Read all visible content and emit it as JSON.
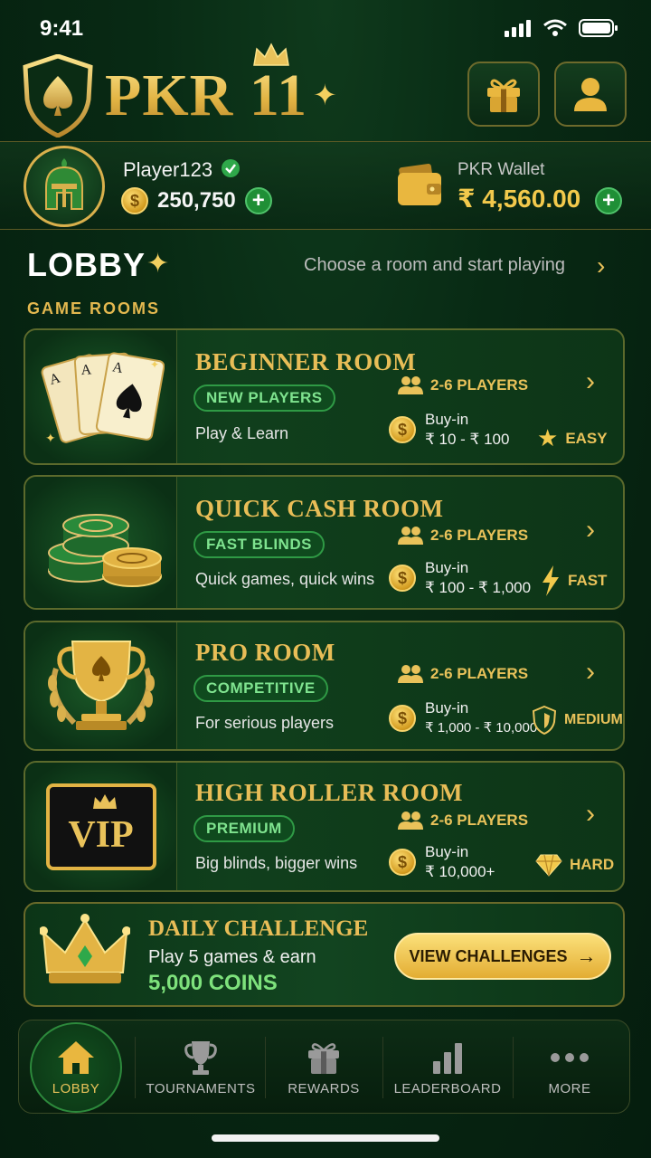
{
  "status": {
    "time": "9:41"
  },
  "header": {
    "brand": "PKR 11",
    "gift_icon": "gift-icon",
    "profile_icon": "user-icon"
  },
  "profile": {
    "username": "Player123",
    "coins": "250,750",
    "wallet_label": "PKR Wallet",
    "wallet_amount": "₹ 4,560.00"
  },
  "lobby": {
    "title": "LOBBY",
    "subtitle": "Choose a room and start playing",
    "section_label": "GAME ROOMS",
    "rooms": [
      {
        "name": "BEGINNER ROOM",
        "tag": "NEW PLAYERS",
        "desc": "Play & Learn",
        "players": "2-6 PLAYERS",
        "buyin_label": "Buy-in",
        "buyin_range": "₹ 10 - ₹ 100",
        "level": "EASY",
        "level_icon": "star-icon"
      },
      {
        "name": "QUICK CASH ROOM",
        "tag": "FAST BLINDS",
        "desc": "Quick games, quick wins",
        "players": "2-6 PLAYERS",
        "buyin_label": "Buy-in",
        "buyin_range": "₹ 100 - ₹ 1,000",
        "level": "FAST",
        "level_icon": "lightning-icon"
      },
      {
        "name": "PRO ROOM",
        "tag": "COMPETITIVE",
        "desc": "For serious players",
        "players": "2-6 PLAYERS",
        "buyin_label": "Buy-in",
        "buyin_range": "₹ 1,000 - ₹ 10,000",
        "level": "MEDIUM",
        "level_icon": "shield-icon"
      },
      {
        "name": "HIGH ROLLER ROOM",
        "tag": "PREMIUM",
        "desc": "Big blinds, bigger wins",
        "players": "2-6 PLAYERS",
        "buyin_label": "Buy-in",
        "buyin_range": "₹ 10,000+",
        "level": "HARD",
        "level_icon": "diamond-icon",
        "art_text": "VIP"
      }
    ]
  },
  "challenge": {
    "title": "DAILY CHALLENGE",
    "line": "Play 5 games & earn",
    "reward": "5,000 COINS",
    "button": "VIEW CHALLENGES"
  },
  "nav": {
    "items": [
      {
        "label": "LOBBY",
        "icon": "home-icon",
        "active": true
      },
      {
        "label": "TOURNAMENTS",
        "icon": "trophy-icon"
      },
      {
        "label": "REWARDS",
        "icon": "gift-icon"
      },
      {
        "label": "LEADERBOARD",
        "icon": "bar-chart-icon"
      },
      {
        "label": "MORE",
        "icon": "more-icon"
      }
    ]
  },
  "colors": {
    "gold": "#e9c25a",
    "green_bg": "#082a14",
    "accent_green": "#7ee27c"
  }
}
